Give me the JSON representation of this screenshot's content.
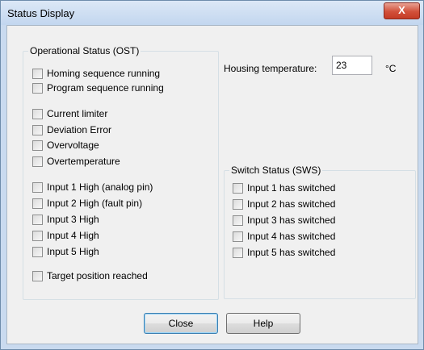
{
  "window": {
    "title": "Status Display",
    "close_glyph": "X"
  },
  "ost": {
    "group_label": "Operational Status (OST)",
    "items": [
      "Homing sequence running",
      "Program sequence running",
      "Current limiter",
      "Deviation Error",
      "Overvoltage",
      "Overtemperature",
      "Input 1 High (analog pin)",
      "Input 2 High (fault pin)",
      "Input 3 High",
      "Input 4 High",
      "Input 5 High",
      "Target position reached"
    ]
  },
  "temperature": {
    "label": "Housing temperature:",
    "value": "23",
    "unit": "°C"
  },
  "sws": {
    "group_label": "Switch Status (SWS)",
    "items": [
      "Input 1 has switched",
      "Input 2 has switched",
      "Input 3 has switched",
      "Input 4 has switched",
      "Input 5 has switched"
    ]
  },
  "buttons": {
    "close": "Close",
    "help": "Help"
  },
  "icons": [
    "close-icon"
  ]
}
